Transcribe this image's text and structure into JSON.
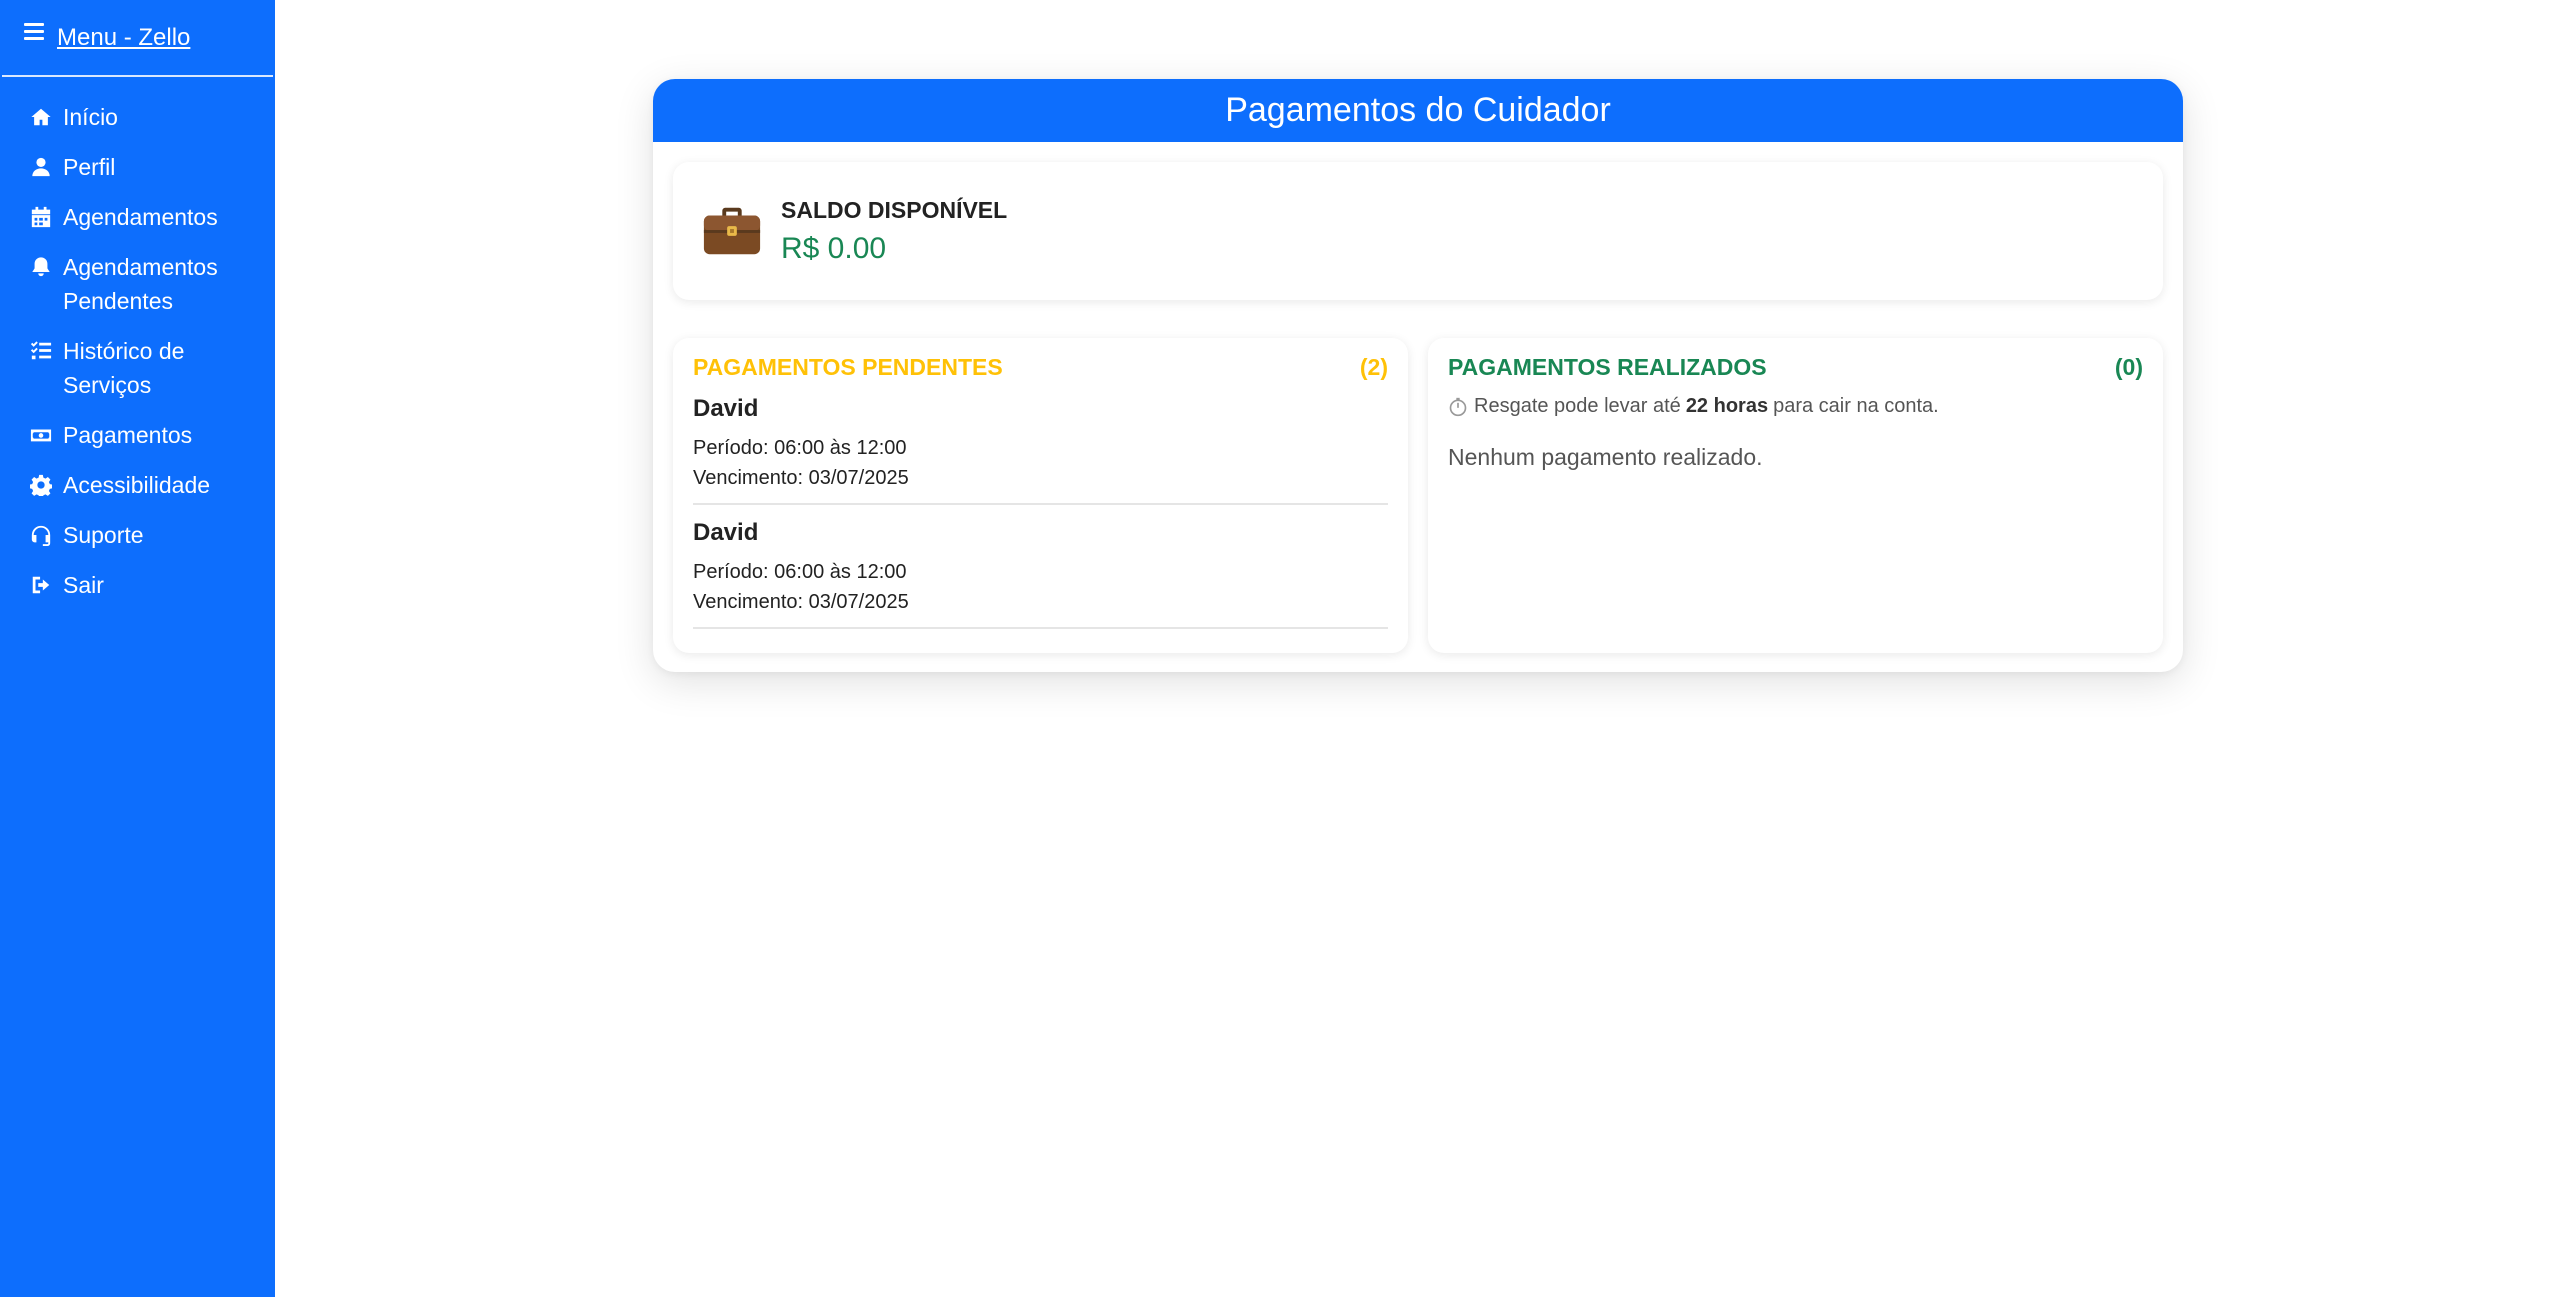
{
  "sidebar": {
    "title": "Menu - Zello",
    "items": [
      {
        "label": "Início",
        "icon": "home-icon"
      },
      {
        "label": "Perfil",
        "icon": "user-icon"
      },
      {
        "label": "Agendamentos",
        "icon": "calendar-icon"
      },
      {
        "label": "Agendamentos Pendentes",
        "icon": "bell-icon"
      },
      {
        "label": "Histórico de Serviços",
        "icon": "list-check-icon"
      },
      {
        "label": "Pagamentos",
        "icon": "money-icon"
      },
      {
        "label": "Acessibilidade",
        "icon": "gear-icon"
      },
      {
        "label": "Suporte",
        "icon": "headset-icon"
      },
      {
        "label": "Sair",
        "icon": "logout-icon"
      }
    ]
  },
  "main": {
    "title": "Pagamentos do Cuidador",
    "saldo": {
      "label": "SALDO DISPONÍVEL",
      "value": "R$ 0.00"
    },
    "pendentes": {
      "title": "PAGAMENTOS PENDENTES",
      "count": "(2)",
      "items": [
        {
          "name": "David",
          "periodo": "Período: 06:00 às 12:00",
          "vencimento": "Vencimento: 03/07/2025"
        },
        {
          "name": "David",
          "periodo": "Período: 06:00 às 12:00",
          "vencimento": "Vencimento: 03/07/2025"
        }
      ]
    },
    "realizados": {
      "title": "PAGAMENTOS REALIZADOS",
      "count": "(0)",
      "note_prefix": "Resgate pode levar até",
      "note_bold": "22 horas",
      "note_suffix": "para cair na conta.",
      "empty": "Nenhum pagamento realizado."
    }
  },
  "colors": {
    "primary": "#0d6efd",
    "pending": "#ffc107",
    "success": "#198754"
  }
}
